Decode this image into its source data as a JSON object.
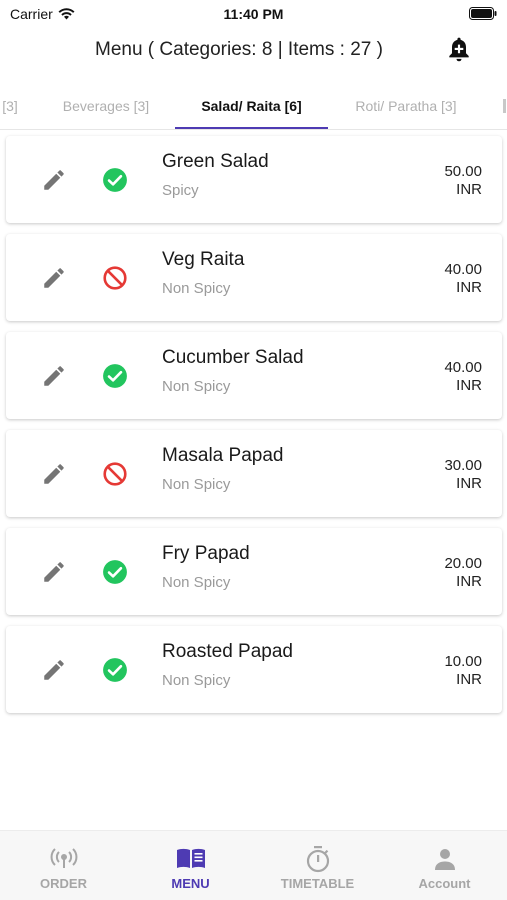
{
  "status_bar": {
    "carrier": "Carrier",
    "time": "11:40 PM"
  },
  "header": {
    "title": "Menu ( Categories: 8 | Items : 27 )"
  },
  "tabs": [
    {
      "label": "[3]",
      "active": false
    },
    {
      "label": "Beverages [3]",
      "active": false
    },
    {
      "label": "Salad/ Raita [6]",
      "active": true
    },
    {
      "label": "Roti/ Paratha [3]",
      "active": false
    }
  ],
  "items": [
    {
      "name": "Green Salad",
      "spice": "Spicy",
      "price": "50.00",
      "currency": "INR",
      "available": true
    },
    {
      "name": "Veg Raita",
      "spice": "Non Spicy",
      "price": "40.00",
      "currency": "INR",
      "available": false
    },
    {
      "name": "Cucumber Salad",
      "spice": "Non Spicy",
      "price": "40.00",
      "currency": "INR",
      "available": true
    },
    {
      "name": "Masala Papad",
      "spice": "Non Spicy",
      "price": "30.00",
      "currency": "INR",
      "available": false
    },
    {
      "name": "Fry Papad",
      "spice": "Non Spicy",
      "price": "20.00",
      "currency": "INR",
      "available": true
    },
    {
      "name": "Roasted Papad",
      "spice": "Non Spicy",
      "price": "10.00",
      "currency": "INR",
      "available": true
    }
  ],
  "bottom_nav": [
    {
      "label": "ORDER",
      "icon": "broadcast-icon",
      "active": false
    },
    {
      "label": "MENU",
      "icon": "menu-book-icon",
      "active": true
    },
    {
      "label": "TIMETABLE",
      "icon": "stopwatch-icon",
      "active": false
    },
    {
      "label": "Account",
      "icon": "person-icon",
      "active": false
    }
  ],
  "colors": {
    "accent": "#4e3bb3",
    "available": "#22c55e",
    "unavailable": "#e53935",
    "icon_gray": "#757575"
  }
}
